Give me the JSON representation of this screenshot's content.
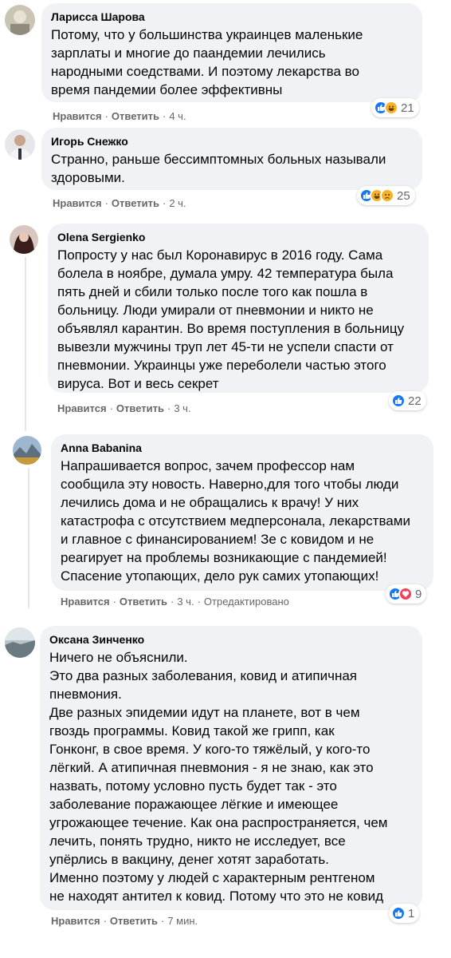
{
  "ui": {
    "like_label": "Нравится",
    "reply_label": "Ответить",
    "dot": "·"
  },
  "comments": [
    {
      "author": "Ларисса Шарова",
      "text": "Потому, что у большинства украинцев маленькие\nзарплаты и многие до паандемии лечились\nнародными соедствами. И поэтому лекарства во\nвремя пандемии более эффективны",
      "time": "4 ч.",
      "reaction_count": "21",
      "reactions": [
        "like-icon",
        "haha-icon"
      ],
      "edited": ""
    },
    {
      "author": "Игорь Снежко",
      "text": "Странно, раньше бессимптомных больных называли\nздоровыми.",
      "time": "2 ч.",
      "reaction_count": "25",
      "reactions": [
        "like-icon",
        "haha-icon",
        "sad-icon"
      ],
      "edited": ""
    },
    {
      "author": "Olena Sergienko",
      "text": "Попросту у нас был Коронавирус в 2016 году. Сама\nболела в ноябре, думала умру. 42 температура была\nпять дней и сбили только после того как пошла в\nбольницу. Люди умирали от пневмонии и никто не\nобъявлял карантин. Во время поступления в больницу\nвывезли мужчины труп лет 45-ти не успели спасти от\nпневмонии. Украинцы уже переболели частью этого\nвируса. Вот и весь секрет",
      "time": "3 ч.",
      "reaction_count": "22",
      "reactions": [
        "like-icon"
      ],
      "edited": ""
    },
    {
      "author": "Anna Babanina",
      "text": "Напрашивается вопрос, зачем профессор нам\nсообщила эту новость. Наверно,для того чтобы люди\nлечились дома и не обращались к врачу! У них\nкатастрофа с отсутствием медперсонала, лекарствами\nи главное с финансированием! Зе с ковидом и не\nреагирует на проблемы возникающие с пандемией!\nСпасение утопающих, дело рук самих утопающих!",
      "time": "3 ч.",
      "reaction_count": "9",
      "reactions": [
        "like-icon",
        "love-icon"
      ],
      "edited": "Отредактировано"
    },
    {
      "author": "Оксана Зинченко",
      "text": "Ничего не объяснили.\nЭто два разных заболевания, ковид и атипичная\nпневмония.\nДве разных эпидемии идут на планете, вот в чем\nгвоздь программы. Ковид такой же грипп, как\nГонконг, в свое время. У кого-то тяжёлый, у кого-то\nлёгкий. А атипичная пневмония - я не знаю, как это\nназвать, потому условно пусть будет так - это\nзаболевание поражающее лёгкие и имеющее\nугрожающее течение. Как она распространяется, чем\nлечить, понять трудно, никто не исследует, все\nупёрлись в вакцину, денег хотят заработать.\nИменно поэтому у людей с характерным рентгеном\nне находят антител к ковид. Потому что это не ковид",
      "time": "7 мин.",
      "reaction_count": "1",
      "reactions": [
        "like-icon"
      ],
      "edited": ""
    }
  ],
  "colors": {
    "bubble": "#f0f2f5",
    "like": "#1877f2",
    "haha": "#f7b125",
    "love": "#f33e58",
    "meta": "#65676b"
  }
}
